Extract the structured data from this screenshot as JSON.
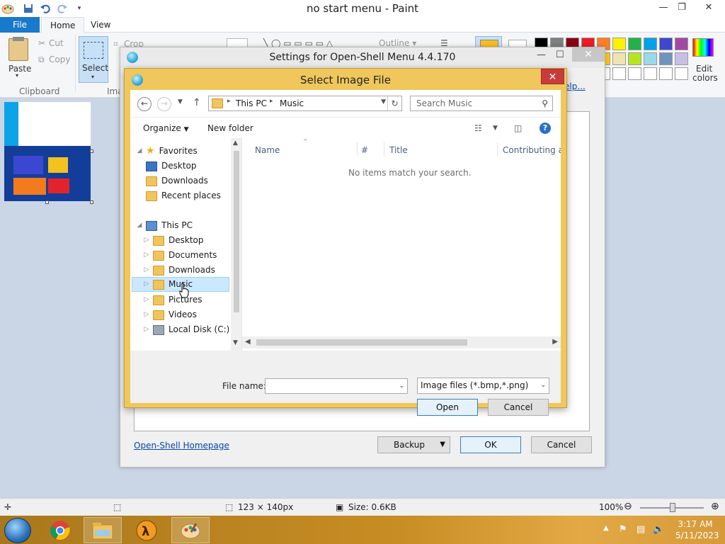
{
  "paint": {
    "title": "no start menu - Paint",
    "menu": {
      "file": "File",
      "home": "Home",
      "view": "View"
    },
    "ribbon": {
      "paste": "Paste",
      "cut": "Cut",
      "copy": "Copy",
      "clipboard_label": "Clipboard",
      "select": "Select",
      "crop": "Crop",
      "outline": "Outline",
      "image_label_partial": "Ima",
      "edit_colors_line1": "Edit",
      "edit_colors_line2": "colors"
    },
    "palette": [
      "#000000",
      "#7f7f7f",
      "#880015",
      "#ed1c24",
      "#ff7f27",
      "#fff200",
      "#22b14c",
      "#00a2e8",
      "#3f48cc",
      "#a349a4",
      "#ffffff",
      "#c3c3c3",
      "#b97a57",
      "#ffaec9",
      "#ffc90e",
      "#efe4b0",
      "#b5e61d",
      "#99d9ea",
      "#7092be",
      "#c8bfe7",
      "#ffffff",
      "#ffffff",
      "#ffffff",
      "#ffffff",
      "#ffffff",
      "#ffffff",
      "#ffffff",
      "#ffffff",
      "#ffffff",
      "#ffffff"
    ],
    "status": {
      "dimensions": "123 × 140px",
      "size": "Size: 0.6KB",
      "zoom": "100%"
    }
  },
  "settings": {
    "title": "Settings for Open-Shell Menu 4.4.170",
    "help_link": "elp...",
    "homepage_link": "Open-Shell Homepage",
    "backup": "Backup",
    "ok": "OK",
    "cancel": "Cancel"
  },
  "dialog": {
    "title": "Select Image File",
    "breadcrumb": [
      "This PC",
      "Music"
    ],
    "search_placeholder": "Search Music",
    "organize": "Organize",
    "new_folder": "New folder",
    "columns": [
      "Name",
      "#",
      "Title",
      "Contributing art"
    ],
    "empty_message": "No items match your search.",
    "favorites_header": "Favorites",
    "favorites": [
      "Desktop",
      "Downloads",
      "Recent places"
    ],
    "this_pc_header": "This PC",
    "this_pc_items": [
      "Desktop",
      "Documents",
      "Downloads",
      "Music",
      "Pictures",
      "Videos",
      "Local Disk (C:)"
    ],
    "file_name_label": "File name:",
    "file_name_value": "",
    "filter": "Image files (*.bmp,*.png)",
    "open": "Open",
    "cancel": "Cancel"
  },
  "taskbar": {
    "time": "3:17 AM",
    "date": "5/11/2023"
  }
}
